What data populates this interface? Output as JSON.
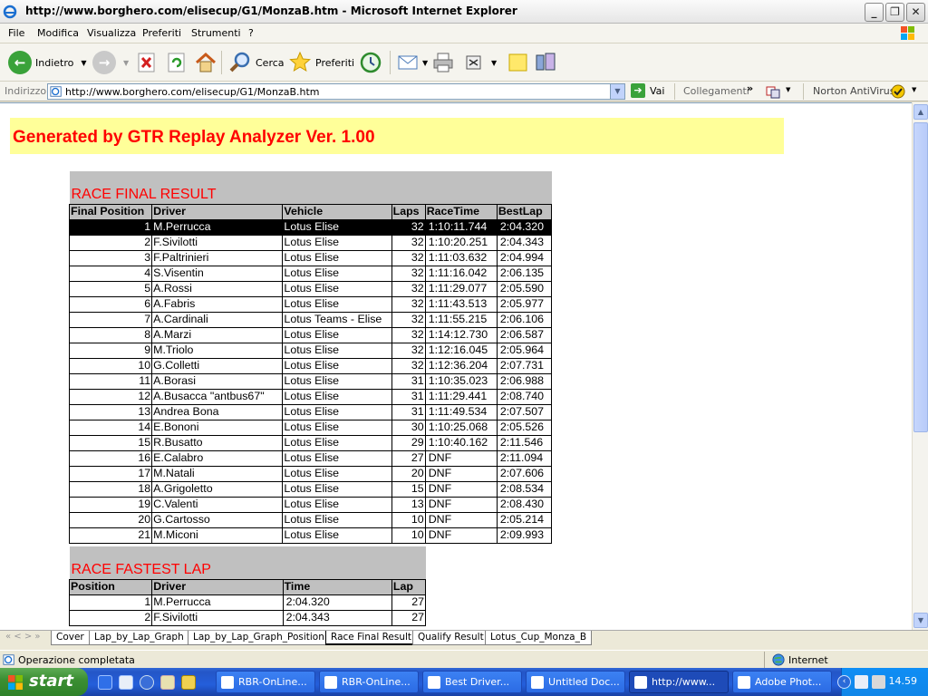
{
  "window": {
    "title": "http://www.borghero.com/elisecup/G1/MonzaB.htm - Microsoft Internet Explorer"
  },
  "menu": [
    "File",
    "Modifica",
    "Visualizza",
    "Preferiti",
    "Strumenti",
    "?"
  ],
  "toolbar": {
    "back": "Indietro",
    "search": "Cerca",
    "favorites": "Preferiti"
  },
  "address": {
    "label": "Indirizzo",
    "url": "http://www.borghero.com/elisecup/G1/MonzaB.htm",
    "go": "Vai",
    "links": "Collegamenti",
    "norton": "Norton AntiVirus"
  },
  "page": {
    "banner": "Generated by GTR Replay Analyzer Ver. 1.00",
    "final": {
      "caption": "RACE FINAL RESULT",
      "headers": [
        "Final Position",
        "Driver",
        "Vehicle",
        "Laps",
        "RaceTime",
        "BestLap"
      ],
      "rows": [
        [
          "1",
          "M.Perrucca",
          "Lotus Elise",
          "32",
          "1:10:11.744",
          "2:04.320"
        ],
        [
          "2",
          "F.Sivilotti",
          "Lotus Elise",
          "32",
          "1:10:20.251",
          "2:04.343"
        ],
        [
          "3",
          "F.Paltrinieri",
          "Lotus Elise",
          "32",
          "1:11:03.632",
          "2:04.994"
        ],
        [
          "4",
          "S.Visentin",
          "Lotus Elise",
          "32",
          "1:11:16.042",
          "2:06.135"
        ],
        [
          "5",
          "A.Rossi",
          "Lotus Elise",
          "32",
          "1:11:29.077",
          "2:05.590"
        ],
        [
          "6",
          "A.Fabris",
          "Lotus Elise",
          "32",
          "1:11:43.513",
          "2:05.977"
        ],
        [
          "7",
          "A.Cardinali",
          "Lotus Teams - Elise",
          "32",
          "1:11:55.215",
          "2:06.106"
        ],
        [
          "8",
          "A.Marzi",
          "Lotus Elise",
          "32",
          "1:14:12.730",
          "2:06.587"
        ],
        [
          "9",
          "M.Triolo",
          "Lotus Elise",
          "32",
          "1:12:16.045",
          "2:05.964"
        ],
        [
          "10",
          "G.Colletti",
          "Lotus Elise",
          "32",
          "1:12:36.204",
          "2:07.731"
        ],
        [
          "11",
          "A.Borasi",
          "Lotus Elise",
          "31",
          "1:10:35.023",
          "2:06.988"
        ],
        [
          "12",
          "A.Busacca \"antbus67\"",
          "Lotus Elise",
          "31",
          "1:11:29.441",
          "2:08.740"
        ],
        [
          "13",
          "Andrea Bona",
          "Lotus Elise",
          "31",
          "1:11:49.534",
          "2:07.507"
        ],
        [
          "14",
          "E.Bononi",
          "Lotus Elise",
          "30",
          "1:10:25.068",
          "2:05.526"
        ],
        [
          "15",
          "R.Busatto",
          "Lotus Elise",
          "29",
          "1:10:40.162",
          "2:11.546"
        ],
        [
          "16",
          "E.Calabro",
          "Lotus Elise",
          "27",
          "DNF",
          "2:11.094"
        ],
        [
          "17",
          "M.Natali",
          "Lotus Elise",
          "20",
          "DNF",
          "2:07.606"
        ],
        [
          "18",
          "A.Grigoletto",
          "Lotus Elise",
          "15",
          "DNF",
          "2:08.534"
        ],
        [
          "19",
          "C.Valenti",
          "Lotus Elise",
          "13",
          "DNF",
          "2:08.430"
        ],
        [
          "20",
          "G.Cartosso",
          "Lotus Elise",
          "10",
          "DNF",
          "2:05.214"
        ],
        [
          "21",
          "M.Miconi",
          "Lotus Elise",
          "10",
          "DNF",
          "2:09.993"
        ]
      ]
    },
    "fastest": {
      "caption": "RACE FASTEST LAP",
      "headers": [
        "Position",
        "Driver",
        "Time",
        "Lap"
      ],
      "rows": [
        [
          "1",
          "M.Perrucca",
          "2:04.320",
          "27"
        ],
        [
          "2",
          "F.Sivilotti",
          "2:04.343",
          "27"
        ]
      ]
    }
  },
  "sheet_tabs": {
    "nav": "« < > »",
    "items": [
      "Cover",
      "Lap_by_Lap_Graph",
      "Lap_by_Lap_Graph_Position",
      "Race Final Result",
      "Qualify Result",
      "Lotus_Cup_Monza_B"
    ],
    "active": "Race Final Result"
  },
  "status": {
    "text": "Operazione completata",
    "zone": "Internet"
  },
  "taskbar": {
    "start": "start",
    "tasks": [
      "RBR-OnLine...",
      "RBR-OnLine...",
      "Best Driver...",
      "Untitled Doc...",
      "http://www...",
      "Adobe Phot..."
    ],
    "active": "http://www...",
    "clock": "14.59"
  }
}
